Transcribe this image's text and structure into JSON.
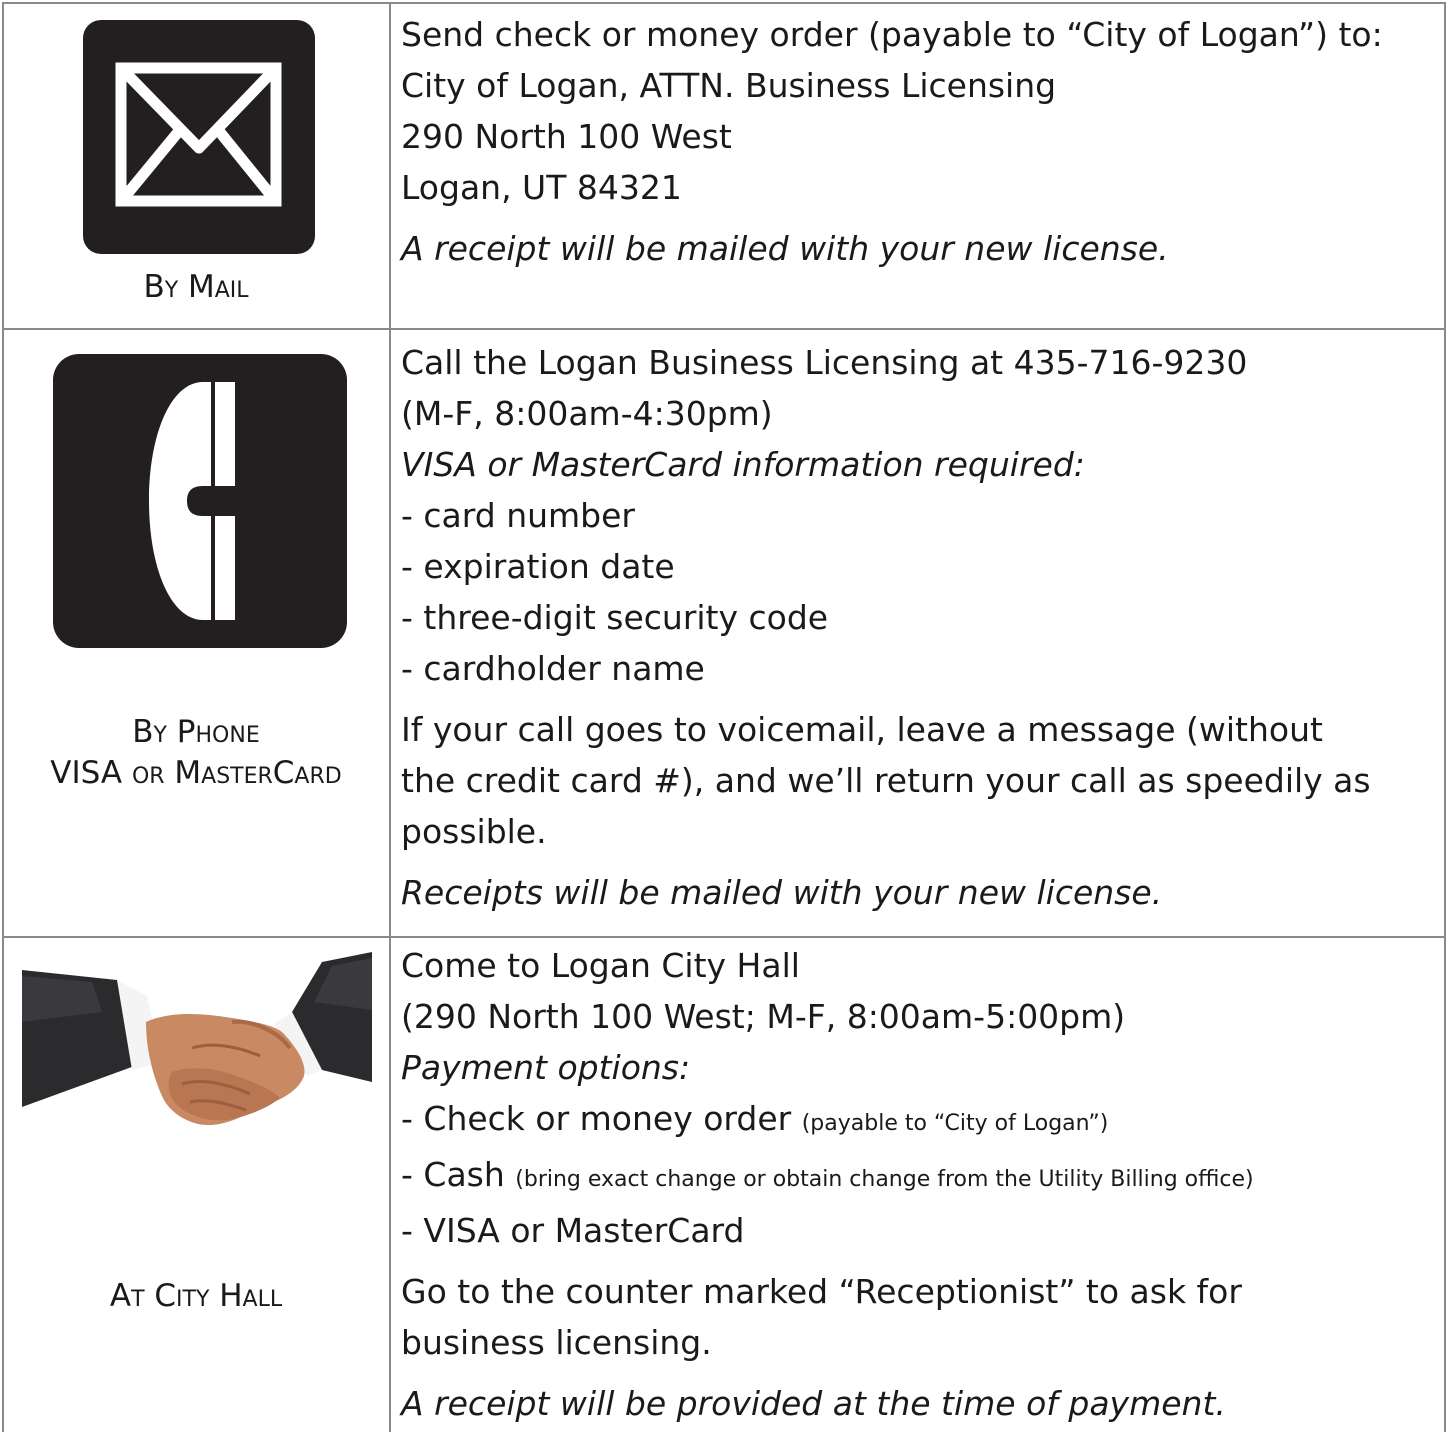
{
  "rows": [
    {
      "icon": "mail-envelope-icon",
      "label_line1": "By Mail",
      "lines": [
        "Send check or money order (payable to “City of Logan”) to:",
        "City of Logan, ATTN. Business Licensing",
        "290 North 100 West",
        "Logan, UT 84321"
      ],
      "note": "A receipt will be mailed with your new license."
    },
    {
      "icon": "telephone-handset-icon",
      "label_line1": "By Phone",
      "label_line2": "VISA or MasterCard",
      "lines": [
        "Call the Logan Business Licensing at 435-716-9230",
        "(M-F, 8:00am-4:30pm)"
      ],
      "requirements_heading": "VISA or MasterCard information required:",
      "requirements": [
        "- card number",
        "- expiration date",
        "- three-digit security code",
        "- cardholder name"
      ],
      "voicemail": [
        "If your call goes to voicemail, leave a message (without",
        "the credit card #), and we’ll return your call as speedily as",
        "possible."
      ],
      "note": "Receipts will be mailed with your new license."
    },
    {
      "icon": "handshake-photo",
      "label_line1": "At City Hall",
      "lines": [
        "Come to Logan City Hall",
        "(290 North 100 West; M-F, 8:00am-5:00pm)"
      ],
      "options_heading": "Payment options:",
      "options": [
        {
          "main": "- Check or money order",
          "detail": "(payable to “City of Logan”)"
        },
        {
          "main": "- Cash",
          "detail": "(bring exact change or obtain change from the Utility Billing office)"
        },
        {
          "main": "- VISA or MasterCard",
          "detail": ""
        }
      ],
      "counter": [
        "Go to the counter marked “Receptionist” to ask for",
        "business licensing."
      ],
      "note": "A receipt will be provided at the time of payment."
    }
  ],
  "colors": {
    "icon_fill": "#231f20",
    "border": "#8a8a8a",
    "text": "#1a1a1a"
  }
}
